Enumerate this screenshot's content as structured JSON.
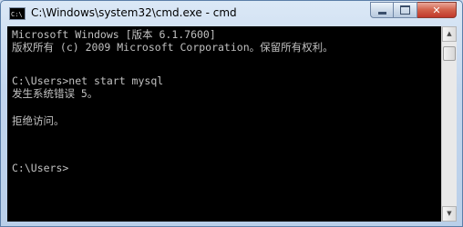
{
  "window": {
    "title": "C:\\Windows\\system32\\cmd.exe - cmd",
    "icon": "cmd-console-icon",
    "icon_text": "C:\\",
    "controls": {
      "minimize": "minimize-icon",
      "maximize": "maximize-icon",
      "close_glyph": "✕"
    }
  },
  "console": {
    "lines": [
      "Microsoft Windows [版本 6.1.7600]",
      "版权所有 (c) 2009 Microsoft Corporation。保留所有权利。",
      "",
      "C:\\Users>net start mysql",
      "发生系统错误 5。",
      "",
      "拒绝访问。",
      "",
      "",
      "C:\\Users>"
    ],
    "colors": {
      "background": "#000000",
      "text": "#c0c0c0"
    }
  },
  "scrollbar": {
    "up_arrow": "▲",
    "down_arrow": "▼"
  }
}
